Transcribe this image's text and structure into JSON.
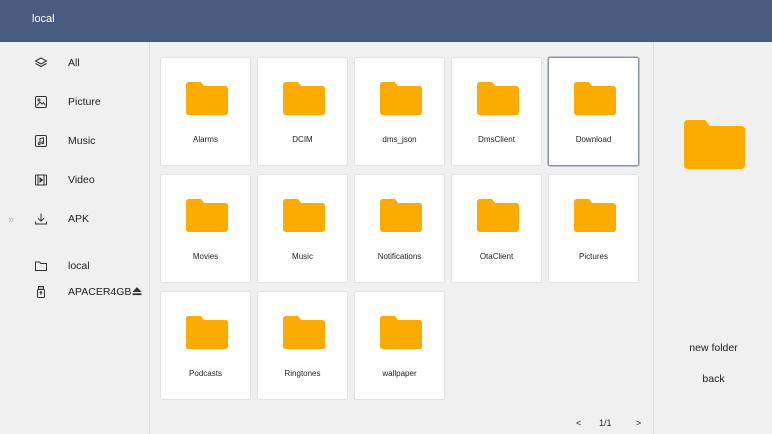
{
  "header": {
    "title": "local"
  },
  "sidebar": {
    "categories": [
      {
        "label": "All",
        "icon": "layers-icon"
      },
      {
        "label": "Picture",
        "icon": "picture-icon"
      },
      {
        "label": "Music",
        "icon": "music-icon"
      },
      {
        "label": "Video",
        "icon": "video-icon"
      },
      {
        "label": "APK",
        "icon": "download-icon"
      }
    ],
    "storage": [
      {
        "label": "local",
        "icon": "folder-outline-icon"
      },
      {
        "label": "APACER4GB",
        "icon": "usb-drive-icon"
      }
    ]
  },
  "folders": [
    {
      "name": "Alarms"
    },
    {
      "name": "DCIM"
    },
    {
      "name": "dms_json"
    },
    {
      "name": "DmsClient"
    },
    {
      "name": "Download",
      "selected": true
    },
    {
      "name": "Movies"
    },
    {
      "name": "Music"
    },
    {
      "name": "Notifications"
    },
    {
      "name": "OtaClient"
    },
    {
      "name": "Pictures"
    },
    {
      "name": "Podcasts"
    },
    {
      "name": "Ringtones"
    },
    {
      "name": "wallpaper"
    }
  ],
  "pagination": {
    "page": "1/1",
    "prev": "<",
    "next": ">"
  },
  "right_panel": {
    "new_folder": "new folder",
    "back": "back"
  },
  "edges": {
    "left_arrow": "»",
    "right_arrow": "«"
  },
  "colors": {
    "header": "#475c7e",
    "folder": "#fcab00",
    "background": "#f0f0f0"
  }
}
